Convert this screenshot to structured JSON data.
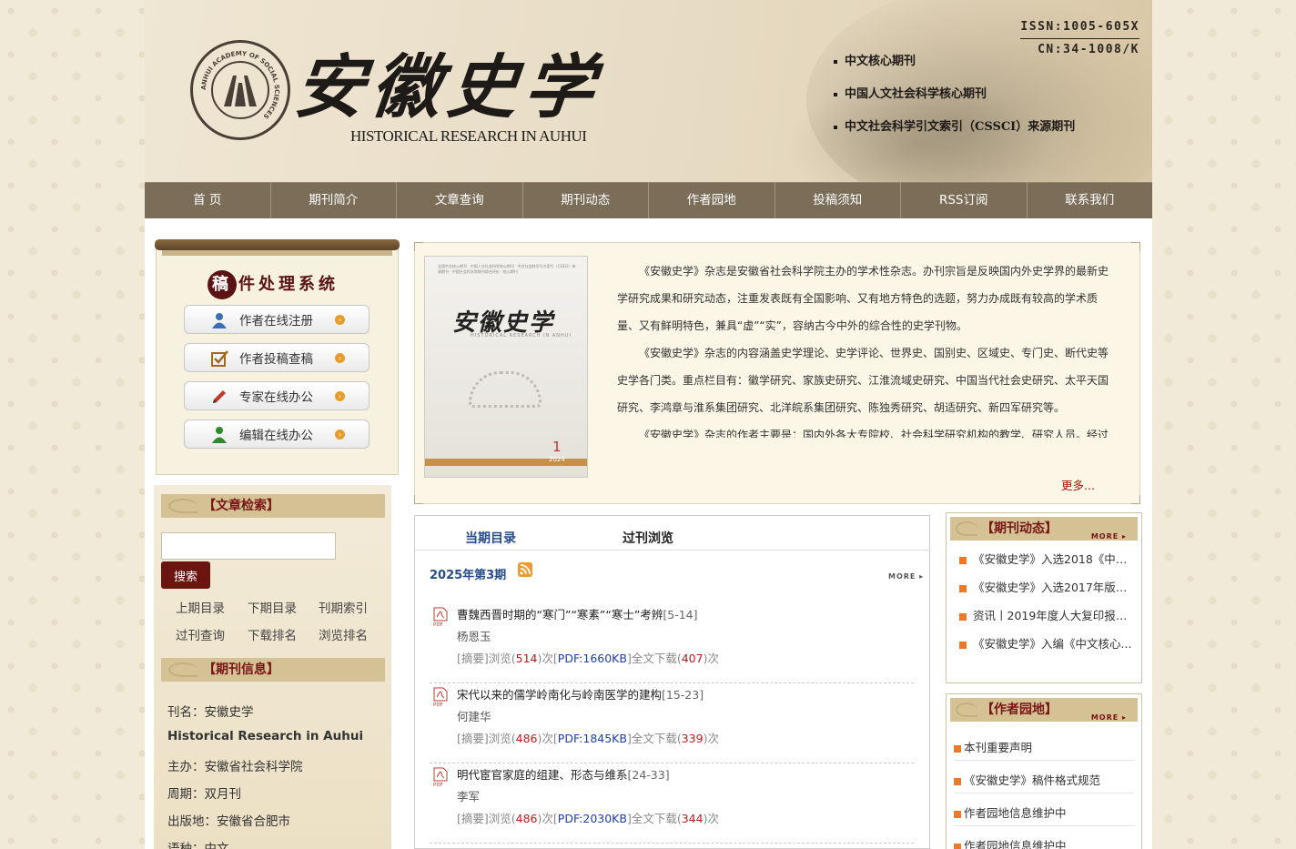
{
  "header": {
    "logo_cn": "安徽史学",
    "logo_en": "HISTORICAL RESEARCH IN AUHUI",
    "seal_text": "ANHUI ACADEMY OF SOCIAL SCIENCES",
    "issn": "ISSN:1005-605X",
    "cn": "CN:34-1008/K",
    "cores": [
      "中文核心期刊",
      "中国人文社会科学核心期刊",
      "中文社会科学引文索引（CSSCI）来源期刊"
    ]
  },
  "nav": [
    "首 页",
    "期刊简介",
    "文章查询",
    "期刊动态",
    "作者园地",
    "投稿须知",
    "RSS订阅",
    "联系我们"
  ],
  "submission": {
    "title_first": "稿",
    "title_rest": "件处理系统",
    "buttons": [
      {
        "label": "作者在线注册",
        "icon": "user-icon"
      },
      {
        "label": "作者投稿查稿",
        "icon": "checkbox-icon"
      },
      {
        "label": "专家在线办公",
        "icon": "pencil-icon"
      },
      {
        "label": "编辑在线办公",
        "icon": "users-icon"
      }
    ]
  },
  "search": {
    "title": "【文章检索】",
    "button": "搜索",
    "placeholder": "",
    "links": [
      "上期目录",
      "下期目录",
      "刊期索引",
      "过刊查询",
      "下载排名",
      "浏览排名"
    ]
  },
  "journal_info": {
    "title": "【期刊信息】",
    "rows": [
      "刊名：安徽史学",
      "Historical Research in Auhui",
      "主办：安徽省社会科学院",
      "周期：双月刊",
      "出版地：安徽省合肥市",
      "语种：中文"
    ]
  },
  "intro": {
    "cover_title": "安徽史学",
    "cover_sub": "HISTORICAL RESEARCH IN ANHUI",
    "cover_top": "全国中文核心期刊 · 中国人文社会科学核心期刊 · 中文社会科学引文索引（CSSCI）来源期刊 · 中国社会科学院期刊综合评价 · 核心期刊",
    "cover_number": "1",
    "cover_year": "2024",
    "paragraphs": [
      "《安徽史学》杂志是安徽省社会科学院主办的学术性杂志。办刊宗旨是反映国内外史学界的最新史学研究成果和研究动态，注重发表既有全国影响、又有地方特色的选题，努力办成既有较高的学术质量、又有鲜明特色，兼具“虚”“实”，容纳古今中外的综合性的史学刊物。",
      "《安徽史学》杂志的内容涵盖史学理论、史学评论、世界史、国别史、区域史、专门史、断代史等史学各门类。重点栏目有：徽学研究、家族史研究、江淮流域史研究、中国当代社会史研究、太平天国研究、李鸿章与淮系集团研究、北洋皖系集团研究、陈独秀研究、胡适研究、新四军研究等。",
      "《安徽史学》杂志的作者主要是：国内外各大专院校、社会科学研究机构的教学、研究人员。经过"
    ],
    "more": "更多..."
  },
  "issue": {
    "tab_current": "当期目录",
    "tab_past": "过刊浏览",
    "heading": "2025年第3期",
    "more": "MORE ▸",
    "articles": [
      {
        "title": "曹魏西晋时期的“寒门”“寒素”“寒士”考辨",
        "pages": "[5-14]",
        "author": "杨恩玉",
        "views": "514",
        "pdf": "PDF:1660KB",
        "downloads": "407"
      },
      {
        "title": "宋代以来的儒学岭南化与岭南医学的建构",
        "pages": "[15-23]",
        "author": "何建华",
        "views": "486",
        "pdf": "PDF:1845KB",
        "downloads": "339"
      },
      {
        "title": "明代宦官家庭的组建、形态与维系",
        "pages": "[24-33]",
        "author": "李军",
        "views": "486",
        "pdf": "PDF:2030KB",
        "downloads": "344"
      }
    ],
    "label_abstract": "[摘要]浏览(",
    "label_times": ")次",
    "label_full": "]全文下载(",
    "label_open": "["
  },
  "news": {
    "title": "【期刊动态】",
    "more": "MORE ▸",
    "items": [
      "《安徽史学》入选2018《中国...",
      "《安徽史学》入选2017年版《...",
      "资讯丨2019年度人大复印报刊...",
      "《安徽史学》入编《中文核心..."
    ]
  },
  "author_garden": {
    "title": "【作者园地】",
    "more": "MORE ▸",
    "items": [
      "本刊重要声明",
      "《安徽史学》稿件格式规范",
      "作者园地信息维护中",
      "作者园地信息维护中"
    ]
  },
  "colors": {
    "nav": "#7b6d57",
    "accent_red": "#7a1515",
    "section_tan": "#d4c295",
    "link_blue": "#264d8a"
  }
}
